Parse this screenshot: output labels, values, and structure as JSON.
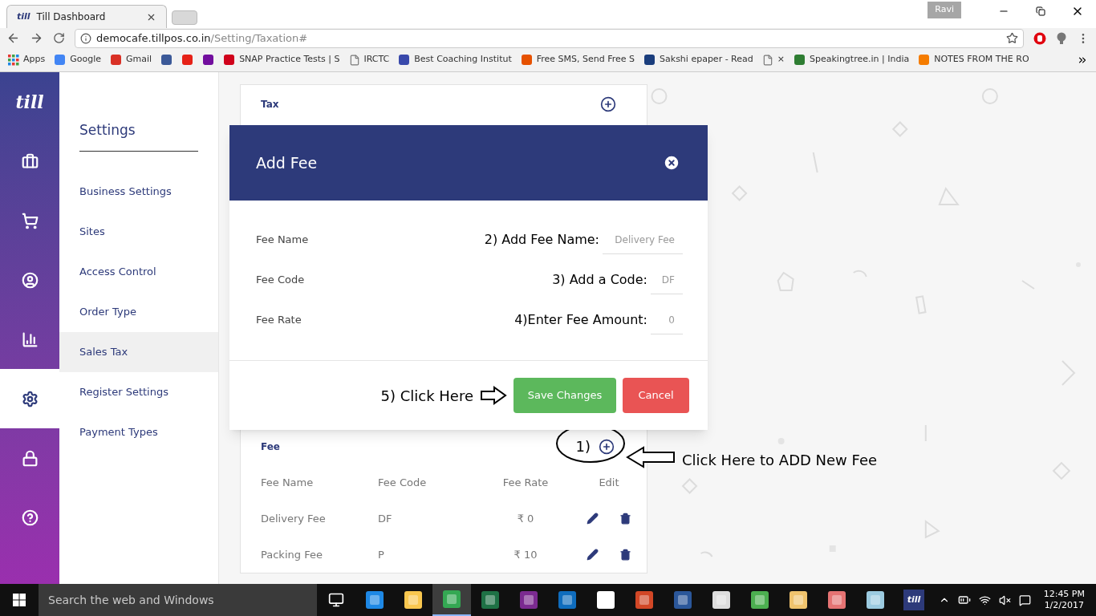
{
  "browser": {
    "tabs": [
      {
        "title": "Till Dashboard",
        "favicon": "till",
        "selected": true
      }
    ],
    "user": "Ravi",
    "url": {
      "host": "democafe.tillpos.co.in",
      "path": "/Setting/Taxation#"
    },
    "bookmarks": [
      {
        "kind": "apps",
        "label": "Apps"
      },
      {
        "kind": "google",
        "label": "Google"
      },
      {
        "kind": "gmail",
        "label": "Gmail"
      },
      {
        "kind": "facebook"
      },
      {
        "kind": "youtube"
      },
      {
        "kind": "yahoo"
      },
      {
        "kind": "jt",
        "label": "SNAP Practice Tests | S"
      },
      {
        "kind": "page",
        "label": "IRCTC"
      },
      {
        "kind": "seal",
        "label": "Best Coaching Institut"
      },
      {
        "kind": "sms",
        "label": "Free SMS, Send Free S"
      },
      {
        "kind": "grid",
        "label": "Sakshi epaper - Read"
      },
      {
        "kind": "page",
        "label": "×"
      },
      {
        "kind": "tree",
        "label": "Speakingtree.in | India"
      },
      {
        "kind": "blogger",
        "label": "NOTES FROM THE RO"
      }
    ]
  },
  "app": {
    "logo": "till",
    "rail": [
      {
        "kind": "briefcase",
        "selected": false
      },
      {
        "kind": "cart",
        "selected": false
      },
      {
        "kind": "user",
        "selected": false
      },
      {
        "kind": "chart",
        "selected": false
      },
      {
        "kind": "gear",
        "selected": true
      },
      {
        "kind": "lock",
        "selected": false
      },
      {
        "kind": "help",
        "selected": false
      }
    ],
    "settings": {
      "title": "Settings",
      "items": [
        {
          "label": "Business Settings",
          "selected": false
        },
        {
          "label": "Sites",
          "selected": false
        },
        {
          "label": "Access Control",
          "selected": false
        },
        {
          "label": "Order Type",
          "selected": false
        },
        {
          "label": "Sales Tax",
          "selected": true
        },
        {
          "label": "Register Settings",
          "selected": false
        },
        {
          "label": "Payment Types",
          "selected": false
        }
      ]
    },
    "tax_card": {
      "title": "Tax"
    },
    "fee_card": {
      "title": "Fee",
      "columns": [
        "Fee Name",
        "Fee Code",
        "Fee Rate",
        "Edit"
      ],
      "rows": [
        {
          "name": "Delivery Fee",
          "code": "DF",
          "rate": "₹ 0"
        },
        {
          "name": "Packing Fee",
          "code": "P",
          "rate": "₹ 10"
        }
      ]
    },
    "modal": {
      "title": "Add Fee",
      "fields": [
        {
          "label": "Fee Name",
          "value": "Delivery Fee",
          "note": "2) Add Fee Name:"
        },
        {
          "label": "Fee Code",
          "value": "DF",
          "note": "3) Add a Code:"
        },
        {
          "label": "Fee Rate",
          "value": "0",
          "note": "4)Enter Fee Amount:"
        }
      ],
      "save": "Save Changes",
      "cancel": "Cancel",
      "save_note": "5) Click Here"
    },
    "add_note": {
      "step": "1)",
      "text": "Click Here to ADD New Fee"
    }
  },
  "taskbar": {
    "search": "Search the web and Windows",
    "time": "12:45 PM",
    "date": "1/2/2017",
    "apps": [
      {
        "kind": "taskview",
        "selected": false
      },
      {
        "kind": "edge",
        "selected": false
      },
      {
        "kind": "explorer",
        "selected": false
      },
      {
        "kind": "chrome",
        "selected": true
      },
      {
        "kind": "excel",
        "selected": false
      },
      {
        "kind": "onenote",
        "selected": false
      },
      {
        "kind": "outlook",
        "selected": false
      },
      {
        "kind": "store",
        "selected": false
      },
      {
        "kind": "powerpoint",
        "selected": false
      },
      {
        "kind": "word",
        "selected": false
      },
      {
        "kind": "calculator",
        "selected": false
      },
      {
        "kind": "slides",
        "selected": false
      },
      {
        "kind": "paint",
        "selected": false
      },
      {
        "kind": "snipping",
        "selected": false
      },
      {
        "kind": "notepad",
        "selected": false
      },
      {
        "kind": "till",
        "selected": false,
        "label": "till"
      }
    ]
  }
}
